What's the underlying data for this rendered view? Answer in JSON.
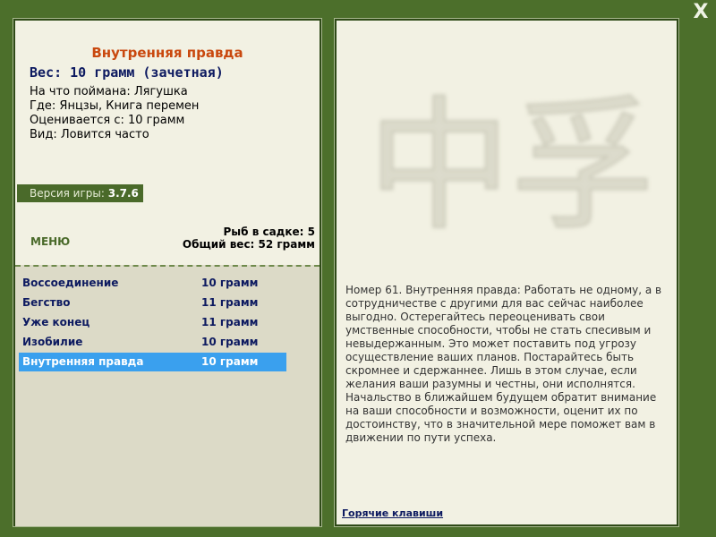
{
  "window": {
    "close_label": "X"
  },
  "fish": {
    "title": "Внутренняя правда",
    "weight": "Вес: 10 грамм (зачетная)",
    "caught_on": "На что поймана: Лягушка",
    "location": "Где: Янцзы, Книга перемен",
    "scored_from": "Оценивается с: 10 грамм",
    "kind": "Вид: Ловится часто"
  },
  "version": {
    "label": "Версия игры:",
    "value": "3.7.6"
  },
  "menu": {
    "label": "МЕНЮ"
  },
  "stats": {
    "fish_count": "Рыб в садке: 5",
    "total_weight": "Общий вес: 52 грамм"
  },
  "catch_list": [
    {
      "name": "Воссоединение",
      "weight": "10 грамм",
      "selected": false
    },
    {
      "name": "Бегство",
      "weight": "11 грамм",
      "selected": false
    },
    {
      "name": "Уже конец",
      "weight": "11 грамм",
      "selected": false
    },
    {
      "name": "Изобилие",
      "weight": "10 грамм",
      "selected": false
    },
    {
      "name": "Внутренняя правда",
      "weight": "10 грамм",
      "selected": true
    }
  ],
  "watermark": {
    "text": "中孚"
  },
  "description": "Номер 61. Внутренняя правда: Работать не одному, а в сотрудничестве с другими для вас сейчас наиболее выгодно. Остерегайтесь переоценивать свои умственные способности, чтобы не стать спесивым и невыдержанным. Это может поставить под угрозу осуществление ваших планов. Постарайтесь быть скромнее и сдержаннее. Лишь в этом случае, если желания ваши разумны и честны, они исполнятся. Начальство в ближайшем будущем обратит внимание на ваши способности и возможности, оценит их по достоинству, что в значительной мере поможет вам в движении по пути успеха.",
  "hotkeys": {
    "label": "Горячие клавиши"
  },
  "colors": {
    "background": "#4c6f2b",
    "panel": "#f2f1e3",
    "selection": "#3aa0ee",
    "title": "#c9480e",
    "text_dark_blue": "#0d1a60"
  }
}
